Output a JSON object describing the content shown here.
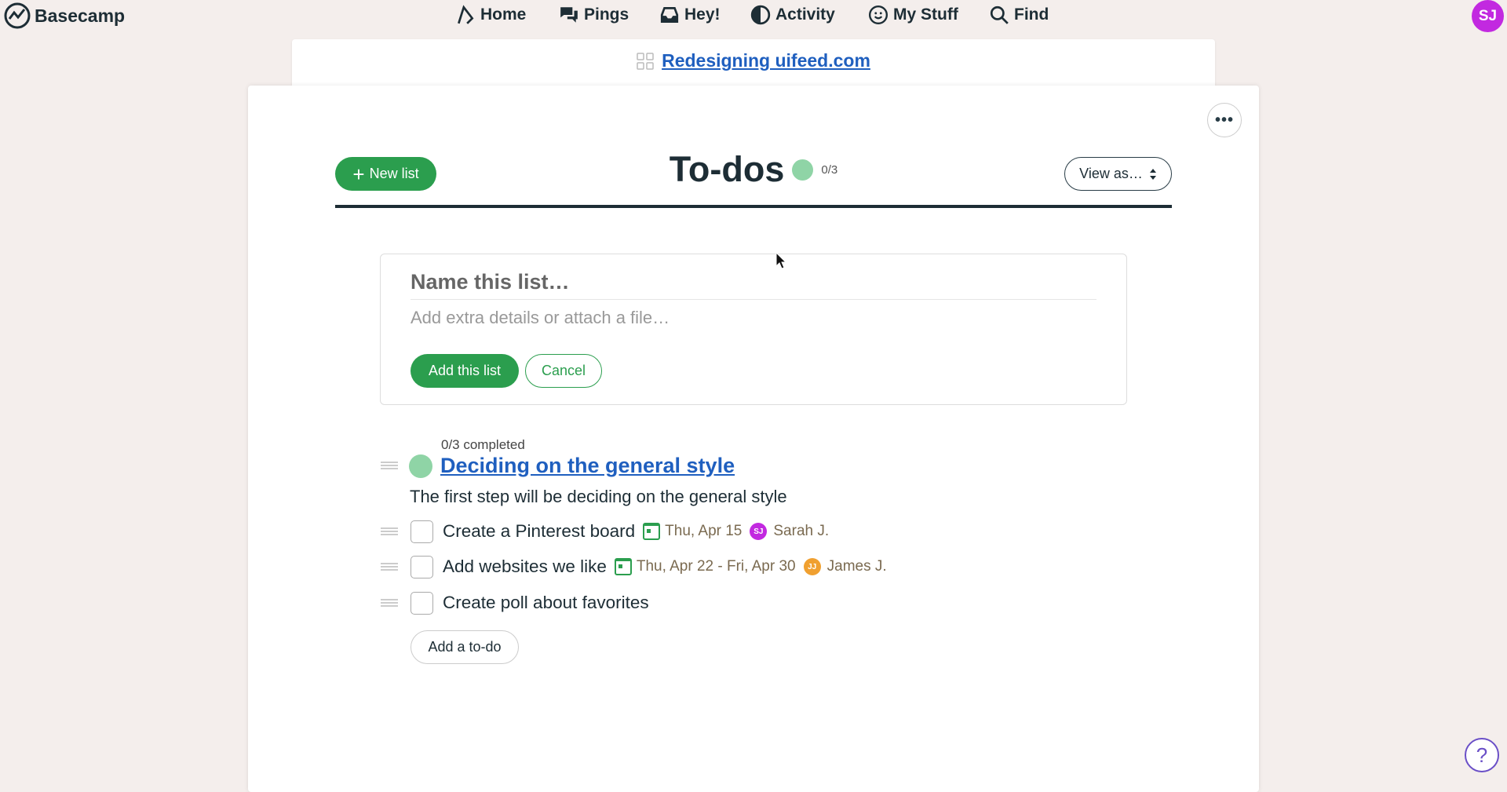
{
  "app": {
    "name": "Basecamp",
    "user_initials": "SJ",
    "avatar_color": "#c229e0"
  },
  "nav": [
    {
      "label": "Home",
      "icon": "home-icon"
    },
    {
      "label": "Pings",
      "icon": "pings-icon"
    },
    {
      "label": "Hey!",
      "icon": "inbox-icon"
    },
    {
      "label": "Activity",
      "icon": "activity-icon"
    },
    {
      "label": "My Stuff",
      "icon": "smiley-icon"
    },
    {
      "label": "Find",
      "icon": "search-icon"
    }
  ],
  "project": {
    "name": "Redesigning uifeed.com"
  },
  "page": {
    "title": "To-dos",
    "progress": "0/3",
    "new_list_label": "New list",
    "view_as_label": "View as…",
    "more_label": "•••"
  },
  "form": {
    "name_placeholder": "Name this list…",
    "details_placeholder": "Add extra details or attach a file…",
    "submit_label": "Add this list",
    "cancel_label": "Cancel"
  },
  "list": {
    "completed": "0/3 completed",
    "title": "Deciding on the general style",
    "description": "The first step will be deciding on the general style",
    "items": [
      {
        "text": "Create a Pinterest board",
        "date": "Thu, Apr 15",
        "assignee": "Sarah J.",
        "initials": "SJ",
        "color": "#c229e0"
      },
      {
        "text": "Add websites we like",
        "date": "Thu, Apr 22 - Fri, Apr 30",
        "assignee": "James J.",
        "initials": "JJ",
        "color": "#f0a030"
      },
      {
        "text": "Create poll about favorites"
      }
    ],
    "add_todo_label": "Add a to-do"
  },
  "help_label": "?",
  "colors": {
    "accent": "#2b9e4e",
    "link": "#1f5fbf",
    "background": "#f4eeec"
  }
}
